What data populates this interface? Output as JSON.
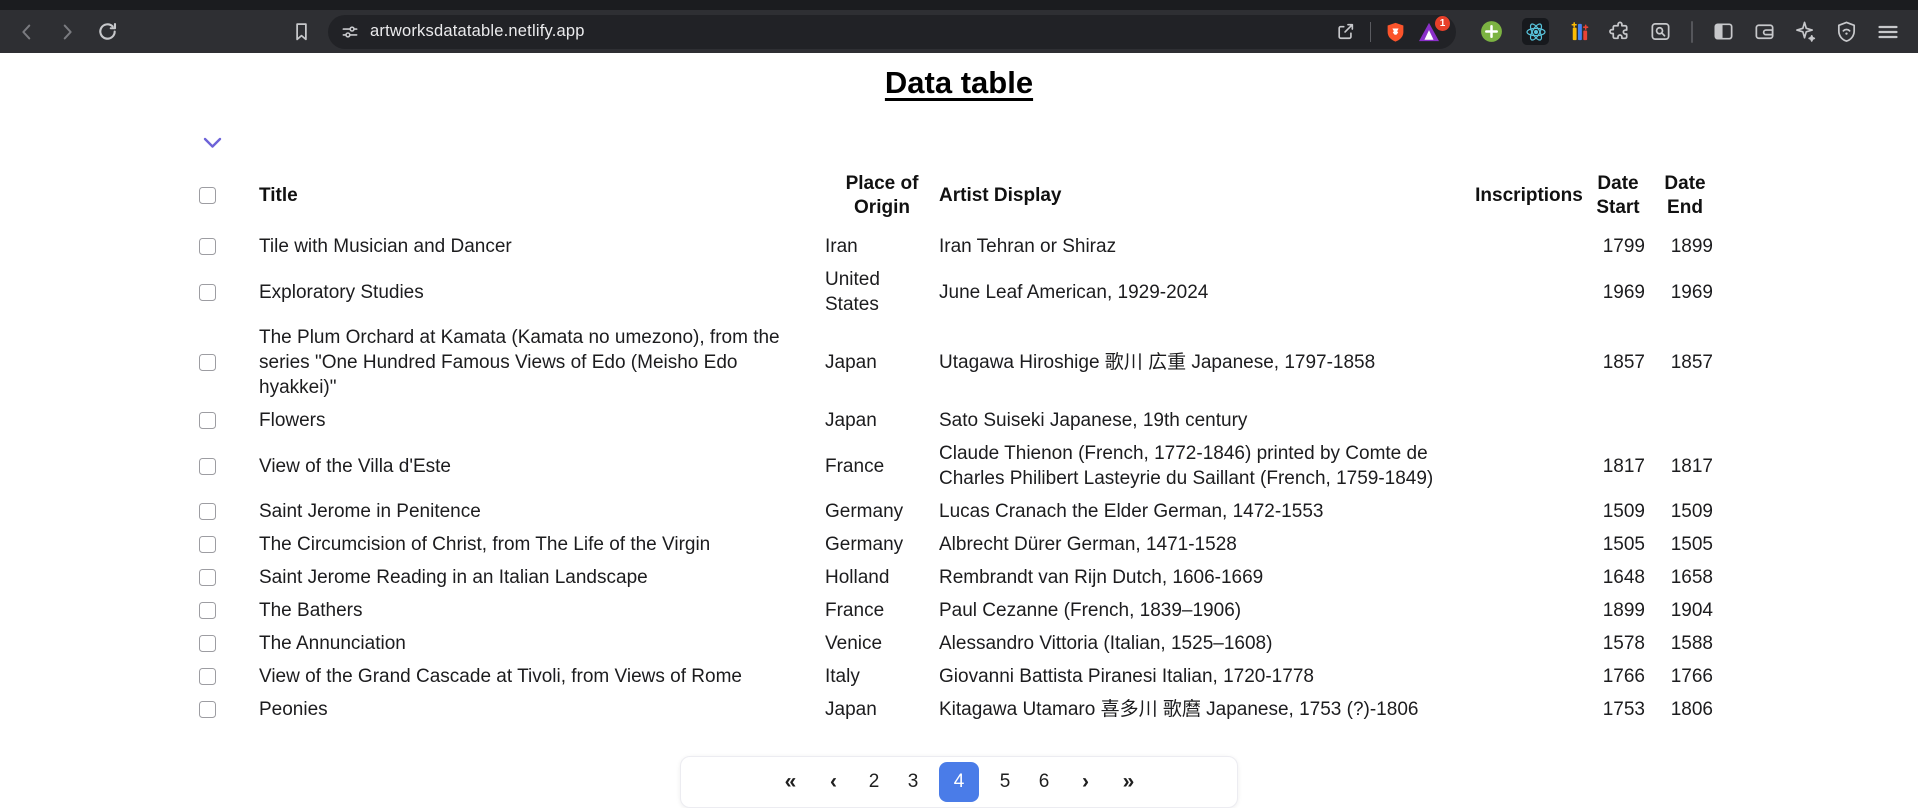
{
  "browser": {
    "url": "artworksdatatable.netlify.app",
    "rewards_badge": "1"
  },
  "page": {
    "title": "Data table"
  },
  "table": {
    "headers": {
      "title": "Title",
      "origin": "Place of Origin",
      "artist": "Artist Display",
      "inscriptions": "Inscriptions",
      "date_start": "Date Start",
      "date_end": "Date End"
    },
    "rows": [
      {
        "title": "Tile with Musician and Dancer",
        "origin": "Iran",
        "artist": "Iran Tehran or Shiraz",
        "inscriptions": "",
        "date_start": "1799",
        "date_end": "1899"
      },
      {
        "title": "Exploratory Studies",
        "origin": "United States",
        "artist": "June Leaf American, 1929-2024",
        "inscriptions": "",
        "date_start": "1969",
        "date_end": "1969"
      },
      {
        "title": "The Plum Orchard at Kamata (Kamata no umezono), from the series \"One Hundred Famous Views of Edo (Meisho Edo hyakkei)\"",
        "origin": "Japan",
        "artist": "Utagawa Hiroshige 歌川 広重 Japanese, 1797-1858",
        "inscriptions": "",
        "date_start": "1857",
        "date_end": "1857"
      },
      {
        "title": "Flowers",
        "origin": "Japan",
        "artist": "Sato Suiseki Japanese, 19th century",
        "inscriptions": "",
        "date_start": "",
        "date_end": ""
      },
      {
        "title": "View of the Villa d'Este",
        "origin": "France",
        "artist": "Claude Thienon (French, 1772-1846) printed by Comte de Charles Philibert Lasteyrie du Saillant (French, 1759-1849)",
        "inscriptions": "",
        "date_start": "1817",
        "date_end": "1817"
      },
      {
        "title": "Saint Jerome in Penitence",
        "origin": "Germany",
        "artist": "Lucas Cranach the Elder German, 1472-1553",
        "inscriptions": "",
        "date_start": "1509",
        "date_end": "1509"
      },
      {
        "title": "The Circumcision of Christ, from The Life of the Virgin",
        "origin": "Germany",
        "artist": "Albrecht Dürer German, 1471-1528",
        "inscriptions": "",
        "date_start": "1505",
        "date_end": "1505"
      },
      {
        "title": "Saint Jerome Reading in an Italian Landscape",
        "origin": "Holland",
        "artist": "Rembrandt van Rijn Dutch, 1606-1669",
        "inscriptions": "",
        "date_start": "1648",
        "date_end": "1658"
      },
      {
        "title": "The Bathers",
        "origin": "France",
        "artist": "Paul Cezanne (French, 1839–1906)",
        "inscriptions": "",
        "date_start": "1899",
        "date_end": "1904"
      },
      {
        "title": "The Annunciation",
        "origin": "Venice",
        "artist": "Alessandro Vittoria (Italian, 1525–1608)",
        "inscriptions": "",
        "date_start": "1578",
        "date_end": "1588"
      },
      {
        "title": "View of the Grand Cascade at Tivoli, from Views of Rome",
        "origin": "Italy",
        "artist": "Giovanni Battista Piranesi Italian, 1720-1778",
        "inscriptions": "",
        "date_start": "1766",
        "date_end": "1766"
      },
      {
        "title": "Peonies",
        "origin": "Japan",
        "artist": "Kitagawa Utamaro 喜多川 歌麿 Japanese, 1753 (?)-1806",
        "inscriptions": "",
        "date_start": "1753",
        "date_end": "1806"
      }
    ]
  },
  "pagination": {
    "first": "«",
    "prev": "‹",
    "pages": [
      "2",
      "3",
      "4",
      "5",
      "6"
    ],
    "active": "4",
    "next": "›",
    "last": "»"
  },
  "colors": {
    "active_page_blue": "#4a7ce8",
    "collapse_chevron_purple": "#6d63d8",
    "brave_shield_orange": "#fb542b",
    "rewards_badge_red": "#e8402a"
  }
}
